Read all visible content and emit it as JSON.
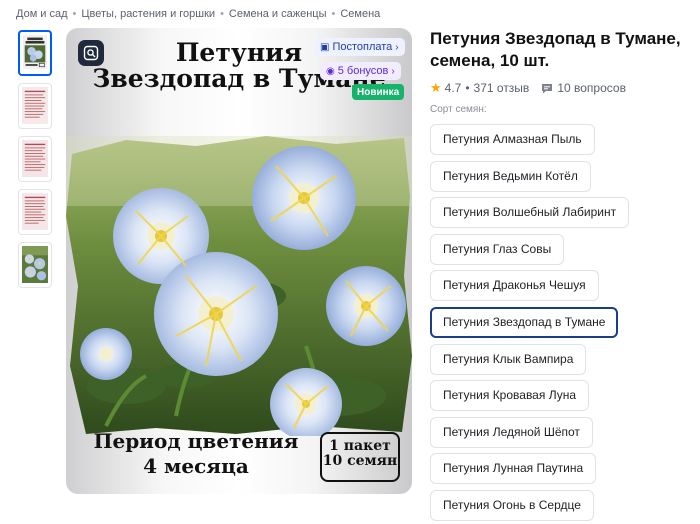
{
  "breadcrumb": [
    "Дом и сад",
    "Цветы, растения и горшки",
    "Семена и саженцы",
    "Семена"
  ],
  "gallery": {
    "thumbnails": [
      {
        "selected": true
      },
      {
        "selected": false
      },
      {
        "selected": false
      },
      {
        "selected": false
      },
      {
        "selected": false
      }
    ]
  },
  "image": {
    "title_line1": "Петуния",
    "title_line2": "Звездопад в Тумане",
    "badge_pay": "Постоплата",
    "badge_bonus": "5 бонусов",
    "badge_new": "Новинка",
    "period_line1": "Период цветения",
    "period_line2": "4 месяца",
    "pack_line1": "1 пакет",
    "pack_line2": "10 семян"
  },
  "product": {
    "title": "Петуния Звездопад в Тумане, семена, 10 шт.",
    "rating": "4.7",
    "reviews": "371 отзыв",
    "questions": "10 вопросов"
  },
  "sort_label": "Сорт семян:",
  "variants": [
    {
      "label": "Петуния Алмазная Пыль",
      "selected": false
    },
    {
      "label": "Петуния Ведьмин Котёл",
      "selected": false
    },
    {
      "label": "Петуния Волшебный Лабиринт",
      "selected": false
    },
    {
      "label": "Петуния Глаз Совы",
      "selected": false
    },
    {
      "label": "Петуния Драконья Чешуя",
      "selected": false
    },
    {
      "label": "Петуния Звездопад в Тумане",
      "selected": true
    },
    {
      "label": "Петуния Клык Вампира",
      "selected": false
    },
    {
      "label": "Петуния Кровавая Луна",
      "selected": false
    },
    {
      "label": "Петуния Ледяной Шёпот",
      "selected": false
    },
    {
      "label": "Петуния Лунная Паутина",
      "selected": false
    },
    {
      "label": "Петуния Огонь в Сердце",
      "selected": false
    }
  ],
  "colors": {
    "accent": "#005bff",
    "selected_border": "#1a3f8a",
    "new_badge": "#16b36a",
    "star": "#ffa600"
  }
}
